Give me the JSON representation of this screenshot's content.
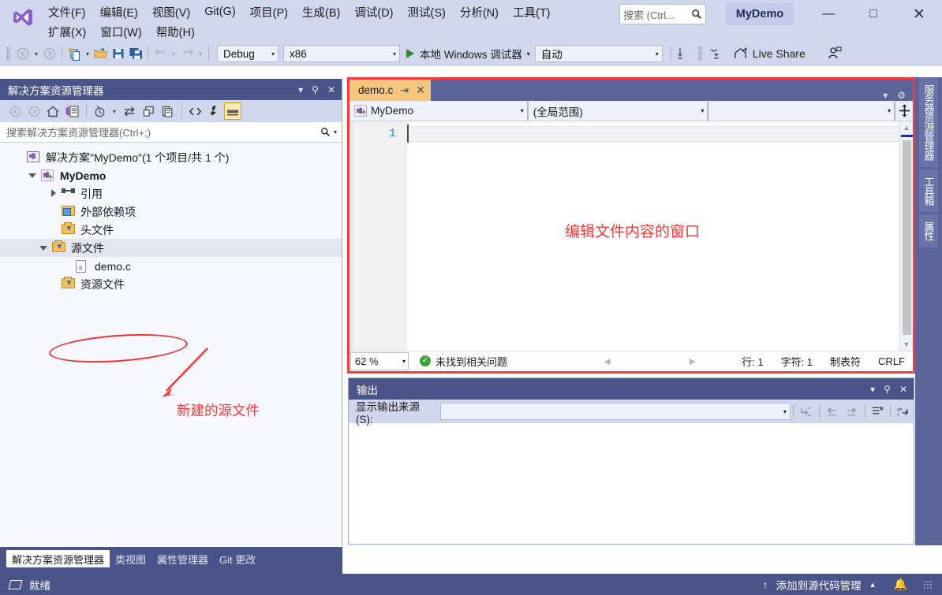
{
  "app": {
    "window_title": "MyDemo",
    "logo": "visual-studio-logo"
  },
  "menu": {
    "row1": [
      {
        "label": "文件(F)",
        "accel": "F"
      },
      {
        "label": "编辑(E)",
        "accel": "E"
      },
      {
        "label": "视图(V)",
        "accel": "V"
      },
      {
        "label": "Git(G)",
        "accel": "G"
      },
      {
        "label": "项目(P)",
        "accel": "P"
      },
      {
        "label": "生成(B)",
        "accel": "B"
      },
      {
        "label": "调试(D)",
        "accel": "D"
      },
      {
        "label": "测试(S)",
        "accel": "S"
      },
      {
        "label": "分析(N)",
        "accel": "N"
      },
      {
        "label": "工具(T)",
        "accel": "T"
      }
    ],
    "row2": [
      {
        "label": "扩展(X)",
        "accel": "X"
      },
      {
        "label": "窗口(W)",
        "accel": "W"
      },
      {
        "label": "帮助(H)",
        "accel": "H"
      }
    ]
  },
  "search": {
    "placeholder": "搜索 (Ctrl...",
    "icon": "magnifier-icon"
  },
  "window_controls": {
    "minimize": "—",
    "maximize": "□",
    "close": "✕"
  },
  "toolbar": {
    "nav_back": "◄",
    "nav_forward": "►",
    "new_item": "new-item-icon",
    "open_file": "open-folder-icon",
    "save": "save-icon",
    "save_all": "save-all-icon",
    "undo": "undo-icon",
    "redo": "redo-icon",
    "config": "Debug",
    "platform": "x86",
    "run_label": "本地 Windows 调试器",
    "target": "自动",
    "live_share": "Live Share"
  },
  "solution_explorer": {
    "title": "解决方案资源管理器",
    "search_placeholder": "搜索解决方案资源管理器(Ctrl+;)",
    "toolbar_icons": [
      "back-icon",
      "forward-icon",
      "home-icon",
      "sync-with-active-doc-icon",
      "pending-changes-icon",
      "refresh-icon",
      "collapse-all-icon",
      "properties-window-icon",
      "show-all-files-icon",
      "properties-icon",
      "preview-selected-items-icon"
    ],
    "tree": [
      {
        "label": "解决方案\"MyDemo\"(1 个项目/共 1 个)",
        "icon": "solution-icon",
        "indent": 0,
        "expander": "none",
        "bold": false
      },
      {
        "label": "MyDemo",
        "icon": "project-icon",
        "indent": 1,
        "expander": "down",
        "bold": true
      },
      {
        "label": "引用",
        "icon": "references-icon",
        "indent": 2,
        "expander": "right",
        "bold": false
      },
      {
        "label": "外部依赖项",
        "icon": "external-deps-icon",
        "indent": 2,
        "expander": "none",
        "bold": false
      },
      {
        "label": "头文件",
        "icon": "filter-folder-icon",
        "indent": 2,
        "expander": "none",
        "bold": false
      },
      {
        "label": "源文件",
        "icon": "filter-folder-icon",
        "indent": 2,
        "expander": "down",
        "bold": false,
        "selected": true
      },
      {
        "label": "demo.c",
        "icon": "c-file-icon",
        "indent": 3,
        "expander": "none",
        "bold": false
      },
      {
        "label": "资源文件",
        "icon": "filter-folder-icon",
        "indent": 2,
        "expander": "none",
        "bold": false
      }
    ],
    "bottom_tabs": [
      {
        "label": "解决方案资源管理器",
        "active": true
      },
      {
        "label": "类视图",
        "active": false
      },
      {
        "label": "属性管理器",
        "active": false
      },
      {
        "label": "Git 更改",
        "active": false
      }
    ]
  },
  "annotations": {
    "color": "#f43b3b",
    "source_file_note": "新建的源文件",
    "editor_note": "编辑文件内容的窗口"
  },
  "editor": {
    "tab_name": "demo.c",
    "tab_pin": "pin-icon",
    "tab_close": "✕",
    "nav_project": "MyDemo",
    "nav_scope": "(全局范围)",
    "nav_member": "",
    "line_number": "1",
    "code": "",
    "status": {
      "zoom": "62 %",
      "issues": "未找到相关问题",
      "line": "行: 1",
      "char": "字符: 1",
      "indent": "制表符",
      "eol": "CRLF"
    }
  },
  "output": {
    "title": "输出",
    "source_label": "显示输出来源(S):",
    "source_value": "",
    "content": "",
    "toolbar_icons": [
      "jump-to-source-icon",
      "previous-message-icon",
      "next-message-icon",
      "clear-all-icon",
      "toggle-word-wrap-icon"
    ]
  },
  "right_rail": {
    "tabs": [
      "服务器资源管理器",
      "工具箱",
      "属性"
    ]
  },
  "statusbar": {
    "ready": "就绪",
    "source_control": "添加到源代码管理",
    "bell": "notification-bell-icon"
  },
  "colors": {
    "chrome": "#d0d6ec",
    "panel_header": "#4b5488",
    "accent_tab": "#f5c77e",
    "annotation_red": "#f43b3b",
    "linenum_blue": "#2b91d6"
  }
}
